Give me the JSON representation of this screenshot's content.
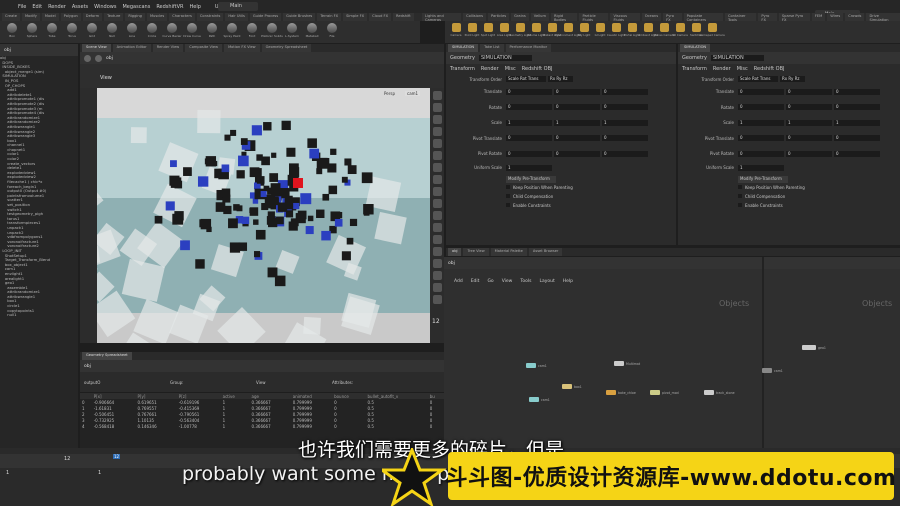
{
  "menu": {
    "items": [
      "File",
      "Edit",
      "Render",
      "Assets",
      "Windows",
      "Megascans",
      "RedshiftVR",
      "Help"
    ],
    "build": "UHD",
    "desktop": "Main",
    "desktop_right": "Main"
  },
  "shelf_left": {
    "tabs": [
      "Create",
      "Modify",
      "Model",
      "Polygon",
      "Deform",
      "Texture",
      "Rigging",
      "Muscles",
      "Characters",
      "Constraints",
      "Hair Utils",
      "Guide Process",
      "Guide Brushes",
      "Terrain FX",
      "Simple FX",
      "Cloud FX",
      "Redshift"
    ],
    "tools": [
      "Box",
      "Sphere",
      "Tube",
      "Torus",
      "Grid",
      "Null",
      "Line",
      "Circle",
      "Curve Bezier",
      "Draw Curve",
      "Path",
      "Spray Paint",
      "Font",
      "Platonic Solids",
      "L-System",
      "Metaball",
      "File"
    ]
  },
  "shelf_right": {
    "tabs": [
      "Lights and Cameras",
      "Collisions",
      "Particles",
      "Grains",
      "Vellum",
      "Rigid Bodies",
      "Particle Fluids",
      "Viscous Fluids",
      "Oceans",
      "Pyro FX",
      "Populate Containers",
      "Container Tools",
      "Pyro FX",
      "Sparse Pyro FX",
      "FEM",
      "Wires",
      "Crowds",
      "Drive Simulation"
    ],
    "tools": [
      "Camera",
      "Point Light",
      "Spot Light",
      "Area Light",
      "Geometry Light",
      "Volume Light",
      "Distant Light",
      "Environment Light",
      "Sky Light",
      "GI Light",
      "Caustic Light",
      "Portal Light",
      "Ambient Light",
      "Stereo Camera",
      "VR Camera",
      "Switcher",
      "Gamepad Camera"
    ]
  },
  "scene_tabs": [
    "Scene View",
    "Animation Editor",
    "Render View",
    "Composite View",
    "Motion FX View",
    "Geometry Spreadsheet"
  ],
  "path": "obj",
  "viewport": {
    "title": "View",
    "persp": "Persp",
    "cam": "cam1",
    "frame": "12"
  },
  "tree": [
    "obj",
    "  DOPS",
    "  INSIDE_BOXES",
    "    object_merge1 (sim)",
    "  SIMULATION",
    "    IN_POS",
    "    OP_CHOPS",
    "      add1",
    "      attribdelete1",
    "      attribpromote1 (dis",
    "      attribpromote2 (dis",
    "      attribpromote3 (m",
    "      attribpromote4 (dis",
    "      attribrandomize1",
    "      attribrandomize2",
    "      attribwrangle1",
    "      attribwrangle2",
    "      attribwrangle3",
    "      box1",
    "      channel1",
    "      chopnet1",
    "      color1",
    "      color2",
    "      create_vectors",
    "      delete1",
    "      explodedview1",
    "      explodedview2",
    "      filecache1 ( chic*x",
    "      foreach_begin1",
    "      output0 (Output #0)",
    "      pointsfromvolume1",
    "      scatter1",
    "      set_position",
    "      switch1",
    "      testgeometry_pigh",
    "      torus1",
    "      transformpieces1",
    "      unpack1",
    "      unpack2",
    "      vdbfrompolygons1",
    "      voronoifracture1",
    "      voronoifracture2",
    "  LOOP_INIT",
    "    ShotSetup1",
    "    Target_Transform_Blend",
    "    box_object1",
    "    cam1",
    "    envlight1",
    "    arealight1",
    "    geo1",
    "      assemble1",
    "      attribrandomize1",
    "      attribwrangle1",
    "      box1",
    "      circle1",
    "      copytopoints1",
    "      null1"
  ],
  "sheet": {
    "tab": "Geometry Spreadsheet",
    "node": "outputO",
    "group_label": "Group:",
    "view_label": "View",
    "attrs_label": "Attributes:",
    "headers": [
      "",
      "P[x]",
      "P[y]",
      "P[z]",
      "active",
      "age",
      "animated",
      "bounce",
      "bullet_autofit_v",
      "bu"
    ],
    "rows": [
      [
        "0",
        "-0.906664",
        "0.619651",
        "-0.619196",
        "1",
        "0.366667",
        "0.799999",
        "0",
        "0.5",
        "0"
      ],
      [
        "1",
        "-1.61831",
        "0.769557",
        "-0.415369",
        "1",
        "0.366667",
        "0.799999",
        "0",
        "0.5",
        "0"
      ],
      [
        "2",
        "-0.506451",
        "0.767661",
        "-0.790561",
        "1",
        "0.366667",
        "0.799999",
        "0",
        "0.5",
        "0"
      ],
      [
        "3",
        "-0.732925",
        "1.10135",
        "-0.563404",
        "1",
        "0.366667",
        "0.799999",
        "0",
        "0.5",
        "0"
      ],
      [
        "4",
        "-0.568418",
        "0.146346",
        "-1.00778",
        "1",
        "0.366667",
        "0.799999",
        "0",
        "0.5",
        "0"
      ]
    ]
  },
  "params_left": {
    "tabs": [
      "Take List",
      "Performance Monitor"
    ],
    "sim_tab": "SIMULATION",
    "type": "Geometry",
    "name": "SIMULATION",
    "subtabs": [
      "Transform",
      "Render",
      "Misc",
      "Redshift OBJ"
    ],
    "transform_order_label": "Transform Order",
    "transform_order": "Scale Rot Trans",
    "rot_order": "Rx Ry Rz",
    "rows": [
      [
        "Translate",
        "0",
        "0",
        "0"
      ],
      [
        "Rotate",
        "0",
        "0",
        "0"
      ],
      [
        "Scale",
        "1",
        "1",
        "1"
      ],
      [
        "Pivot Translate",
        "0",
        "0",
        "0"
      ],
      [
        "Pivot Rotate",
        "0",
        "0",
        "0"
      ]
    ],
    "uniform_label": "Uniform Scale",
    "uniform": "1",
    "modify": "Modify Pre-Transform",
    "checks": [
      "Keep Position When Parenting",
      "Child Compensation",
      "Enable Constraints"
    ]
  },
  "net": {
    "tabs": [
      "obj",
      "Tree View",
      "Material Palette",
      "Asset Browser"
    ],
    "path": "obj",
    "menu": [
      "Add",
      "Edit",
      "Go",
      "View",
      "Tools",
      "Layout",
      "Help"
    ],
    "title": "Objects",
    "title_right": "Objects",
    "nodes": [
      [
        "cam1"
      ],
      [
        "Multimat"
      ],
      [
        "box1"
      ],
      [
        "bake_chloe"
      ],
      [
        "cam1"
      ],
      [
        "pivot_mod"
      ],
      [
        "track_stone"
      ],
      [
        "cam1"
      ],
      [
        "geo1"
      ]
    ]
  },
  "timeline": {
    "frame": "12",
    "start": "1",
    "start2": "1",
    "mark": "12"
  },
  "captions": {
    "cn": "也许我们需要更多的碎片，但是",
    "en": "probably want some more pieces,"
  },
  "banner": "斗斗图-优质设计资源库-www.ddotu.com",
  "colors": {
    "banner_bg": "#f5d416",
    "sim_blue": "#2b3fc0",
    "sim_red": "#e0141e"
  }
}
